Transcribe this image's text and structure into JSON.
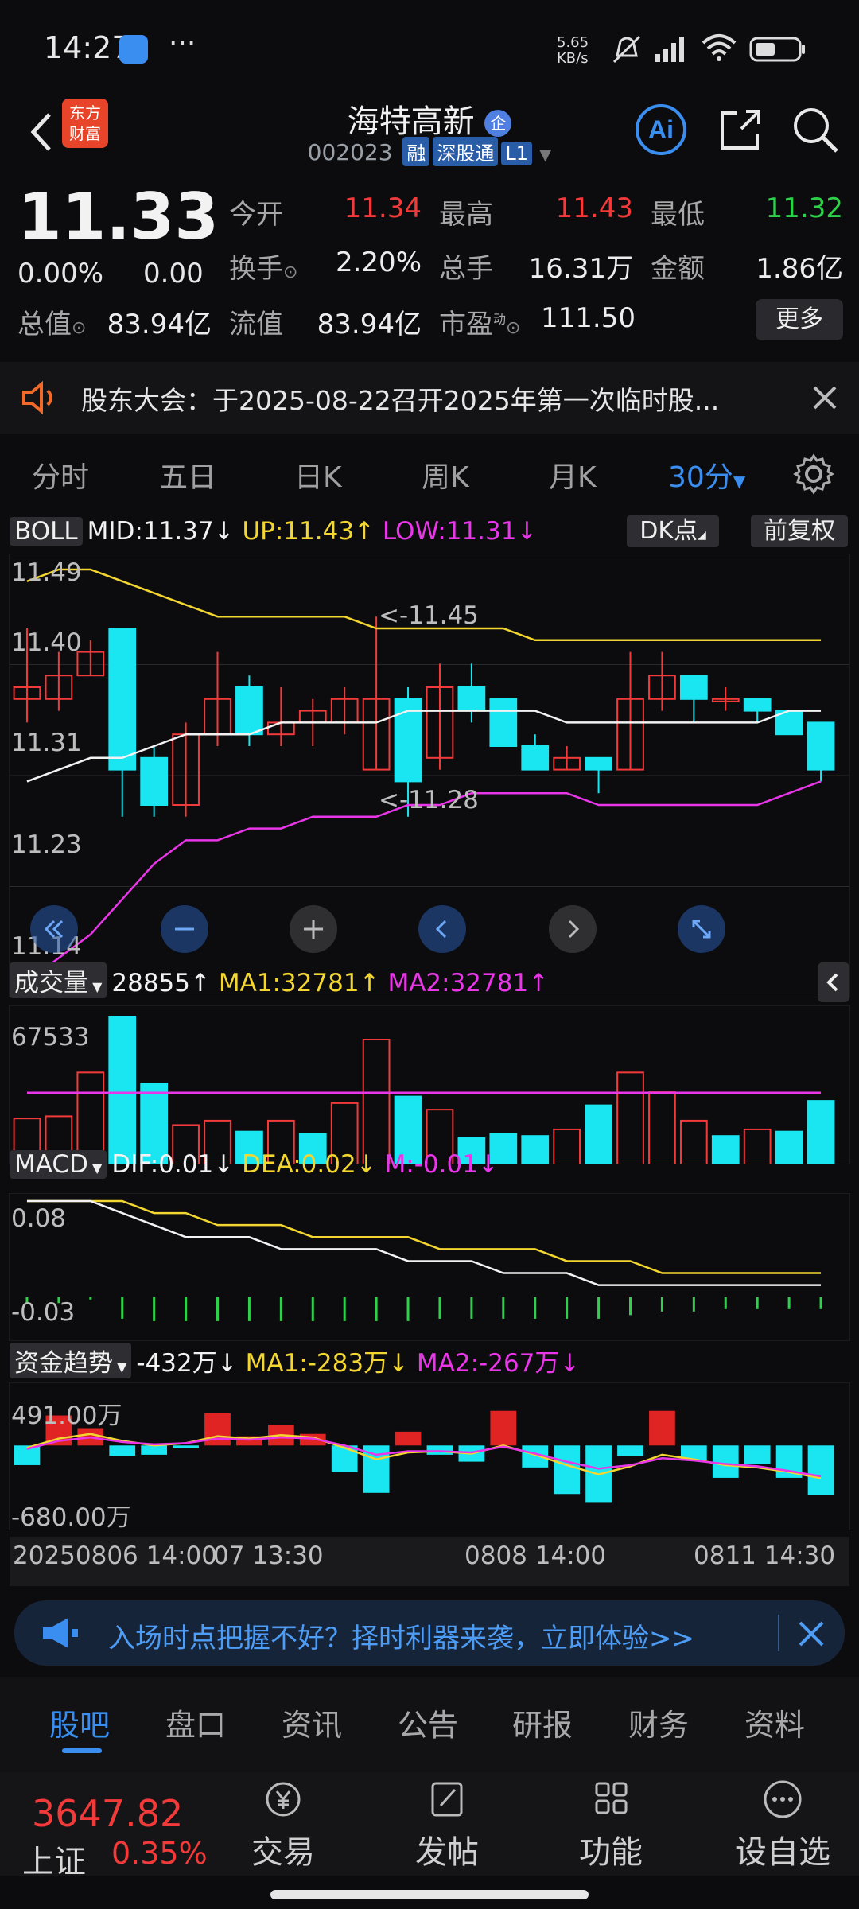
{
  "status_bar": {
    "time": "14:27",
    "net_speed": "5.65\nKB/s"
  },
  "header": {
    "stock_name": "海特高新",
    "code": "002023",
    "tags": [
      "融",
      "深股通",
      "L1"
    ],
    "logo_text": "东方\n财富"
  },
  "quote": {
    "price": "11.33",
    "change_pct": "0.00%",
    "change_amt": "0.00",
    "rows": [
      [
        {
          "label": "今开",
          "value": "11.34",
          "color": "red"
        },
        {
          "label": "最高",
          "value": "11.43",
          "color": "red"
        },
        {
          "label": "最低",
          "value": "11.32",
          "color": "green"
        }
      ],
      [
        {
          "label": "换手",
          "value": "2.20%",
          "color": "white"
        },
        {
          "label": "总手",
          "value": "16.31万",
          "color": "white"
        },
        {
          "label": "金额",
          "value": "1.86亿",
          "color": "white"
        }
      ]
    ],
    "row3": {
      "l1": "总值",
      "v1": "83.94亿",
      "l2": "流值",
      "v2": "83.94亿",
      "l3": "市盈",
      "l3_sup": "动",
      "v3": "111.50"
    },
    "more_label": "更多"
  },
  "notice": {
    "text": "股东大会：于2025-08-22召开2025年第一次临时股..."
  },
  "period_tabs": [
    "分时",
    "五日",
    "日K",
    "周K",
    "月K",
    "30分"
  ],
  "active_period": "30分",
  "boll": {
    "label": "BOLL",
    "mid": "MID:11.37",
    "up": "UP:11.43",
    "low": "LOW:11.31",
    "dk_label": "DK点",
    "fq_label": "前复权",
    "y_ticks": [
      "11.49",
      "11.40",
      "11.31",
      "11.23",
      "11.14"
    ],
    "hi_annot": "<-11.45",
    "lo_annot": "<-11.28"
  },
  "volume": {
    "label": "成交量",
    "value": "28855",
    "ma1": "MA1:32781",
    "ma2": "MA2:32781",
    "y_tick": "67533"
  },
  "macd": {
    "label": "MACD",
    "dif": "DIF:0.01",
    "dea": "DEA:0.02",
    "m": "M:-0.01",
    "y_ticks": [
      "0.08",
      "-0.03"
    ]
  },
  "fund": {
    "label": "资金趋势",
    "value": "-432万",
    "ma1": "MA1:-283万",
    "ma2": "MA2:-267万",
    "y_ticks": [
      "491.00万",
      "-680.00万"
    ]
  },
  "x_axis": [
    "20250806 14:00",
    "07 13:30",
    "0808 14:00",
    "0811 14:30"
  ],
  "banner": {
    "text": "入场时点把握不好？择时利器来袭，立即体验>>"
  },
  "bottom_tabs": [
    "股吧",
    "盘口",
    "资讯",
    "公告",
    "研报",
    "财务",
    "资料"
  ],
  "footer": {
    "index_value": "3647.82",
    "index_name": "上证",
    "index_pct": "0.35%",
    "actions": [
      "交易",
      "发帖",
      "功能",
      "设自选"
    ]
  },
  "colors": {
    "up": "#f23a3a",
    "down": "#19e6f0",
    "accent": "#3a8ef0",
    "yellow": "#f3d630",
    "magenta": "#e836e8"
  },
  "chart_data": {
    "type": "candlestick",
    "boll_ylim": [
      11.14,
      11.49
    ],
    "candles": [
      {
        "o": 11.38,
        "c": 11.39,
        "h": 11.44,
        "l": 11.36
      },
      {
        "o": 11.38,
        "c": 11.4,
        "h": 11.42,
        "l": 11.37
      },
      {
        "o": 11.4,
        "c": 11.42,
        "h": 11.43,
        "l": 11.4
      },
      {
        "o": 11.44,
        "c": 11.32,
        "h": 11.44,
        "l": 11.28
      },
      {
        "o": 11.33,
        "c": 11.29,
        "h": 11.34,
        "l": 11.28
      },
      {
        "o": 11.29,
        "c": 11.35,
        "h": 11.36,
        "l": 11.28
      },
      {
        "o": 11.35,
        "c": 11.38,
        "h": 11.42,
        "l": 11.34
      },
      {
        "o": 11.39,
        "c": 11.35,
        "h": 11.4,
        "l": 11.34
      },
      {
        "o": 11.35,
        "c": 11.36,
        "h": 11.39,
        "l": 11.34
      },
      {
        "o": 11.36,
        "c": 11.37,
        "h": 11.38,
        "l": 11.34
      },
      {
        "o": 11.36,
        "c": 11.38,
        "h": 11.39,
        "l": 11.35
      },
      {
        "o": 11.32,
        "c": 11.38,
        "h": 11.45,
        "l": 11.32
      },
      {
        "o": 11.38,
        "c": 11.31,
        "h": 11.39,
        "l": 11.28
      },
      {
        "o": 11.33,
        "c": 11.39,
        "h": 11.41,
        "l": 11.32
      },
      {
        "o": 11.39,
        "c": 11.37,
        "h": 11.41,
        "l": 11.36
      },
      {
        "o": 11.38,
        "c": 11.34,
        "h": 11.38,
        "l": 11.34
      },
      {
        "o": 11.34,
        "c": 11.32,
        "h": 11.35,
        "l": 11.32
      },
      {
        "o": 11.32,
        "c": 11.33,
        "h": 11.34,
        "l": 11.32
      },
      {
        "o": 11.33,
        "c": 11.32,
        "h": 11.33,
        "l": 11.3
      },
      {
        "o": 11.32,
        "c": 11.38,
        "h": 11.42,
        "l": 11.32
      },
      {
        "o": 11.38,
        "c": 11.4,
        "h": 11.42,
        "l": 11.37
      },
      {
        "o": 11.4,
        "c": 11.38,
        "h": 11.4,
        "l": 11.36
      },
      {
        "o": 11.38,
        "c": 11.38,
        "h": 11.39,
        "l": 11.37
      },
      {
        "o": 11.38,
        "c": 11.37,
        "h": 11.38,
        "l": 11.36
      },
      {
        "o": 11.37,
        "c": 11.35,
        "h": 11.37,
        "l": 11.35
      },
      {
        "o": 11.36,
        "c": 11.32,
        "h": 11.36,
        "l": 11.31
      }
    ],
    "boll_up": [
      11.48,
      11.49,
      11.49,
      11.48,
      11.47,
      11.46,
      11.45,
      11.45,
      11.45,
      11.45,
      11.45,
      11.44,
      11.44,
      11.44,
      11.44,
      11.44,
      11.43,
      11.43,
      11.43,
      11.43,
      11.43,
      11.43,
      11.43,
      11.43,
      11.43,
      11.43
    ],
    "boll_mid": [
      11.31,
      11.32,
      11.33,
      11.33,
      11.34,
      11.35,
      11.35,
      11.35,
      11.36,
      11.36,
      11.36,
      11.36,
      11.37,
      11.37,
      11.37,
      11.37,
      11.37,
      11.36,
      11.36,
      11.36,
      11.36,
      11.36,
      11.36,
      11.36,
      11.37,
      11.37
    ],
    "boll_low": [
      11.14,
      11.16,
      11.18,
      11.21,
      11.24,
      11.26,
      11.26,
      11.27,
      11.27,
      11.28,
      11.28,
      11.28,
      11.29,
      11.29,
      11.3,
      11.3,
      11.3,
      11.3,
      11.29,
      11.29,
      11.29,
      11.29,
      11.29,
      11.29,
      11.3,
      11.31
    ],
    "volume": [
      21000,
      22000,
      42000,
      67533,
      37000,
      18000,
      20000,
      15000,
      20000,
      14000,
      28000,
      57000,
      31000,
      25000,
      12000,
      14000,
      13000,
      16000,
      27000,
      42000,
      33000,
      20000,
      13000,
      16000,
      15000,
      29000
    ],
    "volume_up": [
      true,
      true,
      true,
      false,
      false,
      true,
      true,
      false,
      true,
      false,
      true,
      true,
      false,
      true,
      false,
      false,
      false,
      true,
      false,
      true,
      true,
      true,
      false,
      true,
      false,
      false
    ],
    "volume_ma": [
      32781,
      32781,
      32781,
      32781,
      32781,
      32781,
      32781,
      32781,
      32781,
      32781,
      32781,
      32781,
      32781,
      32781,
      32781,
      32781,
      32781,
      32781,
      32781,
      32781,
      32781,
      32781,
      32781,
      32781,
      32781,
      32781
    ],
    "macd_ylim": [
      -0.03,
      0.08
    ],
    "macd_dif": [
      0.08,
      0.08,
      0.08,
      0.07,
      0.06,
      0.05,
      0.05,
      0.05,
      0.04,
      0.04,
      0.04,
      0.04,
      0.03,
      0.03,
      0.03,
      0.02,
      0.02,
      0.02,
      0.01,
      0.01,
      0.01,
      0.01,
      0.01,
      0.01,
      0.01,
      0.01
    ],
    "macd_dea": [
      0.08,
      0.08,
      0.08,
      0.08,
      0.07,
      0.07,
      0.06,
      0.06,
      0.06,
      0.05,
      0.05,
      0.05,
      0.05,
      0.04,
      0.04,
      0.04,
      0.04,
      0.03,
      0.03,
      0.03,
      0.02,
      0.02,
      0.02,
      0.02,
      0.02,
      0.02
    ],
    "macd_m": [
      -0.005,
      -0.005,
      -0.002,
      -0.018,
      -0.02,
      -0.02,
      -0.02,
      -0.02,
      -0.02,
      -0.02,
      -0.02,
      -0.02,
      -0.02,
      -0.018,
      -0.018,
      -0.018,
      -0.018,
      -0.018,
      -0.018,
      -0.015,
      -0.012,
      -0.012,
      -0.01,
      -0.01,
      -0.01,
      -0.01
    ],
    "fund_ylim": [
      -680,
      491
    ],
    "fund": [
      -170,
      260,
      150,
      -90,
      -80,
      -20,
      280,
      80,
      180,
      100,
      -230,
      -410,
      120,
      -80,
      -140,
      300,
      -190,
      -420,
      -490,
      -90,
      300,
      -130,
      -280,
      -160,
      -280,
      -432
    ],
    "fund_ma1": [
      -20,
      60,
      100,
      40,
      0,
      20,
      80,
      60,
      90,
      70,
      -20,
      -120,
      -60,
      -50,
      -70,
      0,
      -80,
      -170,
      -250,
      -180,
      -80,
      -120,
      -170,
      -190,
      -230,
      -283
    ],
    "fund_ma2": [
      -30,
      40,
      70,
      30,
      10,
      20,
      60,
      50,
      70,
      60,
      0,
      -80,
      -50,
      -50,
      -60,
      -10,
      -70,
      -140,
      -200,
      -170,
      -110,
      -130,
      -160,
      -180,
      -220,
      -267
    ]
  }
}
